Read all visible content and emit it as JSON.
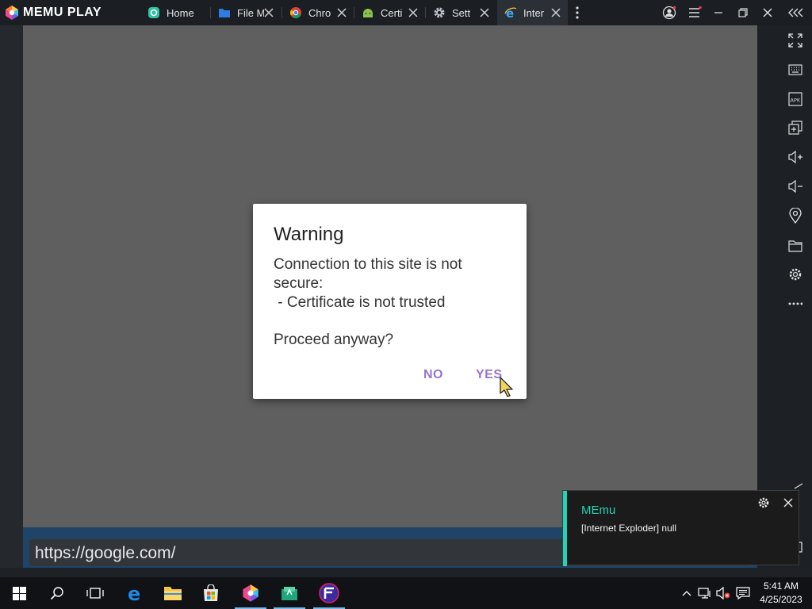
{
  "titlebar": {
    "brand": "MEMU PLAY",
    "tabs": [
      {
        "label": "Home",
        "icon": "memu-home-icon"
      },
      {
        "label": "File M",
        "icon": "folder-icon"
      },
      {
        "label": "Chro",
        "icon": "chrome-icon"
      },
      {
        "label": "Certi",
        "icon": "android-icon"
      },
      {
        "label": "Sett",
        "icon": "gear-icon"
      },
      {
        "label": "Inter",
        "icon": "internet-explorer-icon",
        "active": true
      }
    ]
  },
  "browser": {
    "url": "https://google.com/"
  },
  "dialog": {
    "title": "Warning",
    "line1": "Connection to this site is not",
    "line2": "secure:",
    "line3": " - Certificate is not trusted",
    "proceed": "Proceed anyway?",
    "no_label": "NO",
    "yes_label": "YES"
  },
  "notification": {
    "app": "MEmu",
    "message": "[Internet Exploder] null"
  },
  "taskbar": {
    "time": "5:41 AM",
    "date": "4/25/2023"
  },
  "colors": {
    "accent_dialog": "#9575cd",
    "toast_accent": "#24d3b5",
    "url_band": "#1f4468"
  }
}
